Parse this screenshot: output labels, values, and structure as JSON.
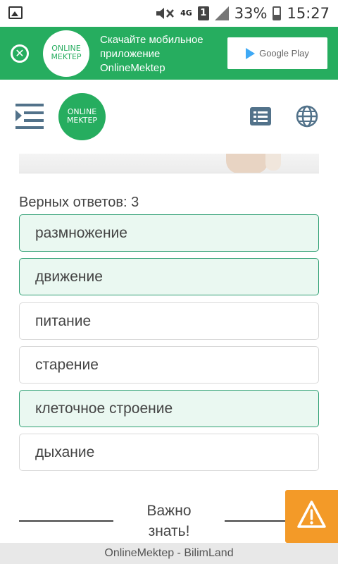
{
  "status_bar": {
    "network": "4G",
    "sim": "1",
    "battery": "33%",
    "time": "15:27"
  },
  "banner": {
    "logo_line1": "ONLINE",
    "logo_line2": "MEKTEP",
    "promo_text": "Скачайте мобильное приложение OnlineMektep",
    "store_label": "Google Play"
  },
  "header": {
    "logo_line1": "ONLINE",
    "logo_line2": "MEKTEP"
  },
  "question": {
    "correct_count_label": "Верных ответов: 3",
    "options": [
      {
        "label": "размножение",
        "selected": true
      },
      {
        "label": "движение",
        "selected": true
      },
      {
        "label": "питание",
        "selected": false
      },
      {
        "label": "старение",
        "selected": false
      },
      {
        "label": "клеточное строение",
        "selected": true
      },
      {
        "label": "дыхание",
        "selected": false
      }
    ]
  },
  "important": {
    "label": "Важно знать!"
  },
  "footer": {
    "text": "OnlineMektep - BilimLand"
  },
  "colors": {
    "brand_green": "#26ad5f",
    "selected_border": "#2e9f73",
    "selected_bg": "#eaf8f1",
    "icon_slate": "#52728a",
    "warning_orange": "#f39a28"
  }
}
